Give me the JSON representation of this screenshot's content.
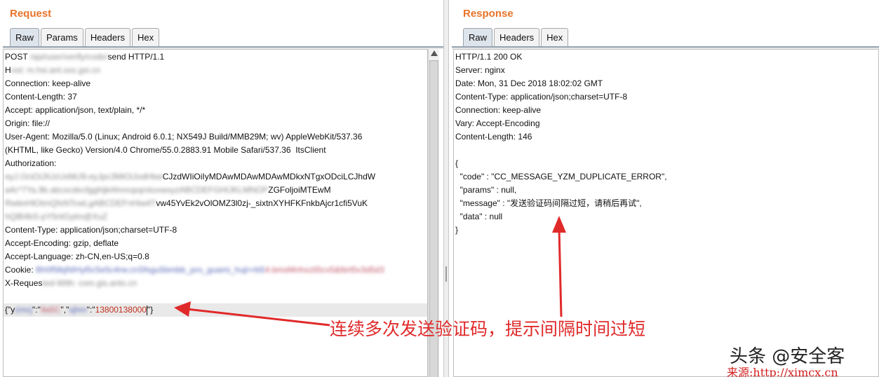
{
  "request": {
    "title": "Request",
    "tabs": [
      "Raw",
      "Params",
      "Headers",
      "Hex"
    ],
    "active_tab": "Raw",
    "lines": {
      "l1_prefix": "POST ",
      "l1_blur": "/api/user/verify/code/",
      "l1_suffix": "send HTTP/1.1",
      "l2_prefix": "H",
      "l2_blur": "ost: m.hsi.ant.sxx.gsi.cn",
      "l3": "Connection: keep-alive",
      "l4": "Content-Length: 37",
      "l5": "Accept: application/json, text/plain, */*",
      "l6": "Origin: file://",
      "l7": "User-Agent: Mozilla/5.0 (Linux; Android 6.0.1; NX549J Build/MMB29M; wv) AppleWebKit/537.36",
      "l8": "(KHTML, like Gecko) Version/4.0 Chrome/55.0.2883.91 Mobile Safari/537.36  ItsClient",
      "l9": "Authorization:",
      "l10_blur": "eyJ.OciOiJIUzUxMiJ9.eyJpc3MiOiJodHtwi",
      "l10_suffix": "CJzdWIiOiIyMDAwMDAwMDAwMDkxNTgxODciLCJhdW",
      "l11_blur": "a4c*7Ya.9b.abcxcdecfgghijk#lmnopqrstuvwxyzABCDEFGHIJKLMNOP",
      "l11_suffix": "ZGFoljoiMTEwM",
      "l12_blur": "RwbnHlOtmQfxNTcwLgABCDEFnHiw4T",
      "l12_suffix": "vw45YvEk2vOlOMZ3l0zj-_sixtnXYHFKFnkbAjcr1cfi5VuK",
      "l13_blur": "hQlB4bS-pY5ntGytm@XuZ",
      "l14": "Content-Type: application/json;charset=UTF-8",
      "l15": "Accept-Encoding: gzip, deflate",
      "l16": "Accept-Language: zh-CN,en-US;q=0.8",
      "l17_prefix": "Cookie: ",
      "l17_blur_blue": "Bh0f5lbjNIHyl5c5e5c4rw.cnSfsgu5bmbb_pro_guami_huji=rb5",
      "l17_blur_red": "4.bmsMnhxzIi5cv5&lbrt5v3d5d3",
      "l18_prefix": "X-Reques",
      "l18_blur": "ted-With: com.gis.ants.cn",
      "l20_prefix": "{\"y",
      "l20_blur1": "zmcj",
      "l20_mid1": "\":\"",
      "l20_blur2": "9a5C",
      "l20_mid2": "\",\"",
      "l20_blur3": "sjhm",
      "l20_mid3": "\":\"",
      "l20_value": "13800138000",
      "l20_end": "\"}"
    }
  },
  "response": {
    "title": "Response",
    "tabs": [
      "Raw",
      "Headers",
      "Hex"
    ],
    "active_tab": "Raw",
    "lines": {
      "l1": "HTTP/1.1 200 OK",
      "l2": "Server: nginx",
      "l3": "Date: Mon, 31 Dec 2018 18:02:02 GMT",
      "l4": "Content-Type: application/json;charset=UTF-8",
      "l5": "Connection: keep-alive",
      "l6": "Vary: Accept-Encoding",
      "l7": "Content-Length: 146",
      "l9": "{",
      "l10": "  \"code\" : \"CC_MESSAGE_YZM_DUPLICATE_ERROR\",",
      "l11": "  \"params\" : null,",
      "l12": "  \"message\" : \"发送验证码间隔过短，请稍后再试\",",
      "l13": "  \"data\" : null",
      "l14": "}"
    }
  },
  "annotation": "连续多次发送验证码，提示间隔时间过短",
  "watermark": "头条 @安全客",
  "source": "来源:http://ximcx.cn",
  "colors": {
    "accent_title": "#e8742a",
    "annotation_red": "#e02a2a"
  }
}
